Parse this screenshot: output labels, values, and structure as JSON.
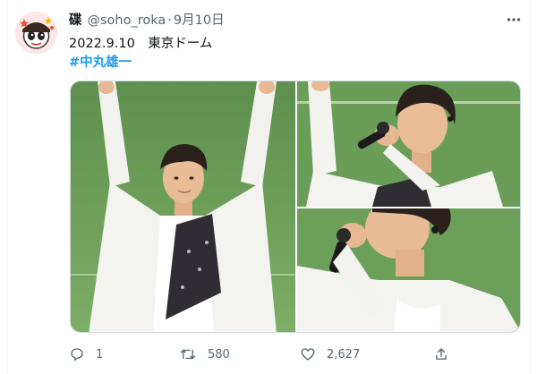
{
  "tweet": {
    "display_name": "碟",
    "handle": "@soho_roka",
    "separator": "·",
    "date": "9月10日",
    "text_line1": "2022.9.10　東京ドーム",
    "hashtag": "#中丸雄一"
  },
  "actions": {
    "reply_count": "1",
    "retweet_count": "580",
    "like_count": "2,627"
  },
  "icons": {
    "avatar": "cartoon-character-avatar",
    "more": "more-dots-icon",
    "reply": "reply-bubble-icon",
    "retweet": "retweet-arrows-icon",
    "like": "heart-icon",
    "share": "share-upload-icon"
  },
  "colors": {
    "text": "#0f1419",
    "secondary": "#536471",
    "hashtag": "#1d9bf0",
    "stadium_grass": "#6fa05c",
    "shirt": "#f2f2f0"
  }
}
